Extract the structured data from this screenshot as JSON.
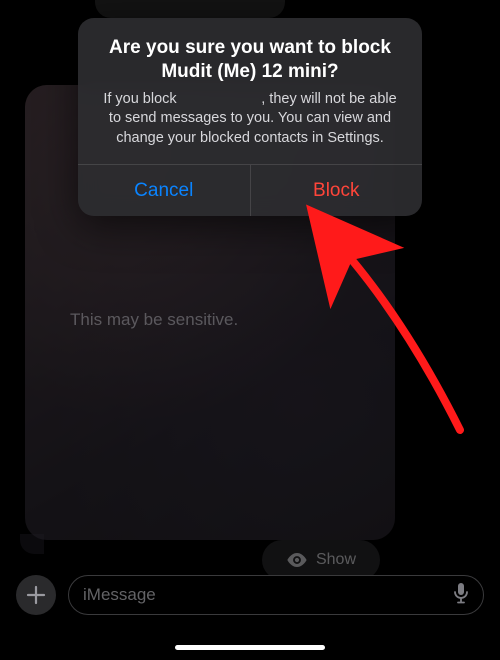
{
  "modal": {
    "title": "Are you sure you want to block Mudit (Me) 12 mini?",
    "message": "If you block                     , they will not be able to send messages to you. You can view and change your blocked contacts in Settings.",
    "cancel_label": "Cancel",
    "block_label": "Block"
  },
  "chat": {
    "sensitive_label": "This may be sensitive.",
    "show_label": "Show"
  },
  "compose": {
    "placeholder": "iMessage"
  },
  "colors": {
    "accent_blue": "#0a84ff",
    "destructive_red": "#ff453a"
  }
}
